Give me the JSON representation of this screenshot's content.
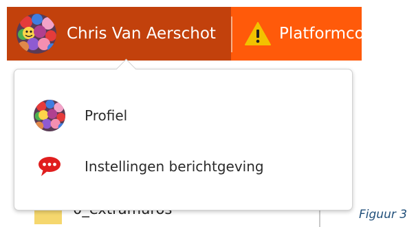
{
  "topbar": {
    "user_name": "Chris Van Aerschot",
    "platform_label": "Platformco",
    "colors": {
      "user_bg": "#c2410c",
      "platform_bg": "#ff5a0a",
      "warning": "#f2c200"
    }
  },
  "dropdown": {
    "items": [
      {
        "label": "Profiel",
        "icon": "avatar-icon"
      },
      {
        "label": "Instellingen berichtgeving",
        "icon": "chat-bubble-icon"
      }
    ]
  },
  "background": {
    "folder_label": "0_extramuros",
    "folder_icon": "folder-icon"
  },
  "caption": "Figuur 3"
}
